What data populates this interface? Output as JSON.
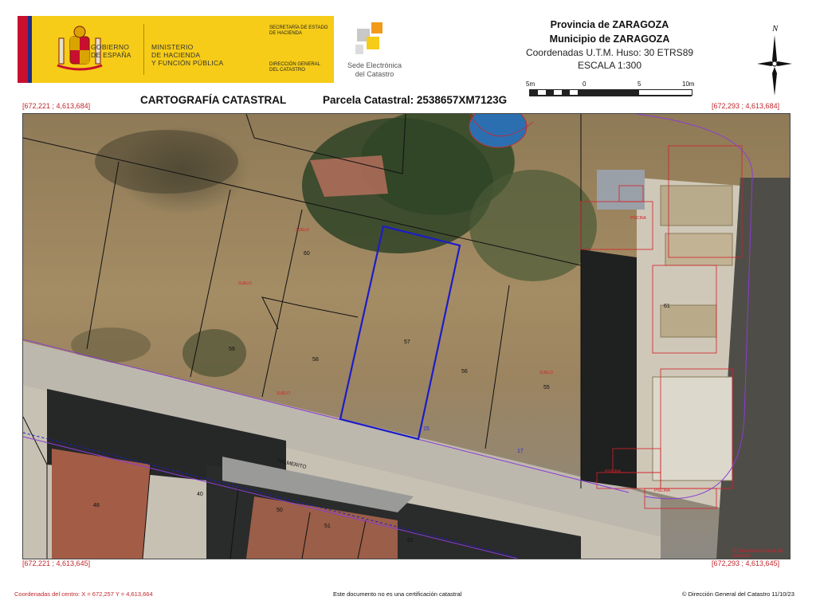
{
  "header": {
    "gov_name": [
      "GOBIERNO",
      "DE ESPAÑA"
    ],
    "ministry": [
      "MINISTERIO",
      "DE HACIENDA",
      "Y FUNCIÓN PÚBLICA"
    ],
    "secretaria": [
      "SECRETARÍA DE ESTADO",
      "DE HACIENDA"
    ],
    "direccion": [
      "DIRECCIÓN GENERAL",
      "DEL CATASTRO"
    ],
    "sede": [
      "Sede Electrónica",
      "del Catastro"
    ],
    "province": "Provincia de ZARAGOZA",
    "municipality": "Municipio de ZARAGOZA",
    "coord_system": "Coordenadas U.T.M. Huso: 30 ETRS89",
    "scale_title": "ESCALA 1:300",
    "scale_ticks": [
      "5m",
      "0",
      "5",
      "10m"
    ],
    "north_label": "N"
  },
  "subtitle": {
    "cartography": "CARTOGRAFÍA CATASTRAL",
    "parcel": "Parcela Catastral: 2538657XM7123G"
  },
  "corners": {
    "top_left": "[672,221 ; 4,613,684]",
    "top_right": "[672,293 ; 4,613,684]",
    "bottom_left": "[672,221 ; 4,613,645]",
    "bottom_right": "[672,293 ; 4,613,645]"
  },
  "map": {
    "numbers": [
      "60",
      "59",
      "58",
      "57",
      "56",
      "55",
      "61",
      "48",
      "50",
      "51",
      "52",
      "40"
    ],
    "street_name": "PALMERITO",
    "street_codes": [
      "15",
      "17"
    ],
    "land_use_labels": [
      "SUELO",
      "SUELO",
      "SUELO",
      "SUELO"
    ],
    "structure_labels": [
      "PISCINA",
      "PISCINA",
      "PISCINA"
    ],
    "corner_stamp": "© Dirección General del Catastro"
  },
  "footer": {
    "center_coords": "Coordenadas del centro: X = 672,257 Y = 4,613,664",
    "disclaimer": "Este documento no es una certificación catastral",
    "copyright": "© Dirección General del Catastro 11/10/23"
  },
  "colors": {
    "gov_yellow": "#f6cc18",
    "flag_red": "#c8102e",
    "parcel_blue": "#1c1cc8",
    "cadastre_red": "#d4202a"
  }
}
